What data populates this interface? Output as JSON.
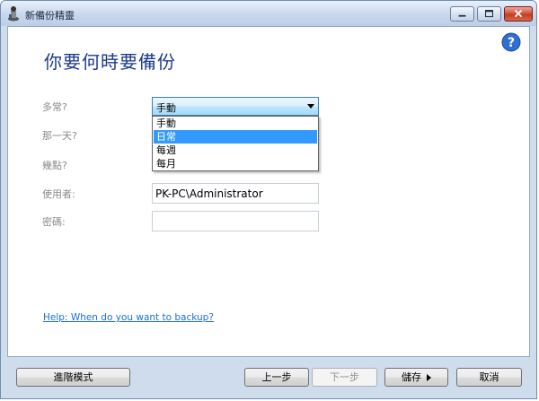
{
  "window": {
    "title": "新備份精靈",
    "icon": "backup-wizard-icon"
  },
  "caption_buttons": {
    "minimize": "minimize-icon",
    "maximize": "maximize-icon",
    "close": "close-icon"
  },
  "main": {
    "heading": "你要何時要備份",
    "help_icon": "help-icon",
    "fields": {
      "frequency_label": "多常?",
      "frequency_value": "手動",
      "day_label": "那一天?",
      "time_label": "幾點?",
      "user_label": "使用者:",
      "user_value": "PK-PC\\Administrator",
      "password_label": "密碼:",
      "password_value": ""
    },
    "dropdown_options": [
      "手動",
      "日常",
      "每週",
      "每月"
    ],
    "dropdown_selected_index": 1,
    "help_link": "Help: When do you want to backup?"
  },
  "footer": {
    "advanced_label": "進階模式",
    "back_label": "上一步",
    "next_label": "下一步",
    "save_label": "儲存",
    "cancel_label": "取消"
  },
  "colors": {
    "heading": "#1b3a8a",
    "selection": "#3399ff",
    "link": "#1a6fd1",
    "close_button": "#c23c23"
  }
}
